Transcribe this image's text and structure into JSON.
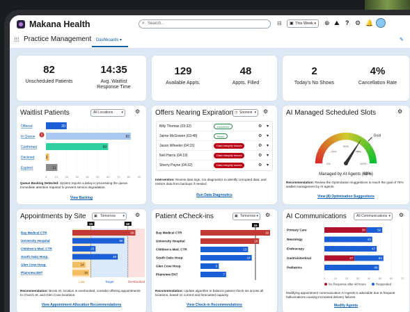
{
  "app": {
    "title": "Makana Health",
    "search_placeholder": "Search...",
    "nav_title": "Practice Management",
    "tab": "Dashboards",
    "period": "This Week"
  },
  "kpis": [
    {
      "value": "82",
      "label": "Unscheduled Patients"
    },
    {
      "value": "14:35",
      "label": "Avg. Waitlist Response Time"
    },
    {
      "value": "129",
      "label": "Available Appts."
    },
    {
      "value": "48",
      "label": "Appts. Filled"
    },
    {
      "value": "2",
      "label": "Today's No Shows"
    },
    {
      "value": "4%",
      "label": "Cancellation Rate"
    }
  ],
  "waitlist": {
    "title": "Waitlist Patients",
    "filter": "All Locations",
    "summary_bold": "Queue Backlog Detected:",
    "summary": "System reports a delay in processing the queue. Immediate attention required to prevent service degradation.",
    "link": "View Backlog",
    "badge": "!",
    "chart_data": {
      "type": "bar",
      "categories": [
        "Offered",
        "In Queue",
        "Confirmed",
        "Declined",
        "Expired"
      ],
      "values": [
        20,
        82,
        60,
        3,
        11
      ],
      "colors": [
        "#1b5fd6",
        "#a9c8f2",
        "#2fd0a0",
        "#f5bd62",
        "#8a8a8a"
      ],
      "xticks": [
        "0",
        "10",
        "20",
        "30",
        "40",
        "50",
        "60",
        "70",
        "80",
        "90"
      ],
      "xlim": [
        0,
        90
      ]
    }
  },
  "offers": {
    "title": "Offers Nearing Expiration",
    "filter": "Soonest",
    "rows": [
      {
        "name": "Billy Thomas (03:32)",
        "status": "Delivered",
        "kind": "ok"
      },
      {
        "name": "Jaime McGowen (03:48)",
        "status": "Read",
        "kind": "ok"
      },
      {
        "name": "Jason Wheeler (04:15)",
        "status": "Data Integrity Issues",
        "kind": "bad"
      },
      {
        "name": "Neil Harris (04:19)",
        "status": "Data Integrity Issues",
        "kind": "bad"
      },
      {
        "name": "Sherry Payne (04:32)",
        "status": "Data Integrity Issues",
        "kind": "bad"
      }
    ],
    "summary_bold": "Intervention:",
    "summary": "Review data logs, run diagnostics to identify corrupted data, and restore data from backups if needed.",
    "link": "Run Data Diagnostics"
  },
  "ai_slots": {
    "title": "AI Managed Scheduled Slots",
    "gauge_labels": [
      "0%",
      "25%",
      "50%",
      "75%",
      "100%"
    ],
    "goal_label": "Goal",
    "caption_pre": "Managed by AI Agents (",
    "caption_val": "68%",
    "caption_post": ")",
    "summary_bold": "Recommendation:",
    "summary": "Review the Optimization Suggestions to reach the goal of 75% waitlist management by AI agents.",
    "link": "View (8) Optimization Suggestions",
    "chart_data": {
      "type": "gauge",
      "value": 68,
      "goal": 75,
      "min": 0,
      "max": 100
    }
  },
  "appts_site": {
    "title": "Appointments by Site",
    "filter": "Tomorrow",
    "top_labels": [
      "20",
      "60"
    ],
    "legend": [
      "Low",
      "Target",
      "Overbooked"
    ],
    "summary_bold": "Recommendation:",
    "summary": "Brook St. location is overbooked, consider offering appointments to Church St. and Glen Cove locations.",
    "link": "View Appointment Allocation Recommendations",
    "chart_data": {
      "type": "bar",
      "categories": [
        "Bay Medical CTR",
        "University Hospital",
        "Children's Med. CTR",
        "South Oaks Hosp.",
        "Glen Cove Hosp.",
        "Plainview ENT"
      ],
      "values": [
        68,
        56,
        25,
        49,
        14,
        18
      ],
      "low_threshold": 20,
      "target_threshold": 60
    }
  },
  "echeckins": {
    "title": "Patient eCheck-ins",
    "filter": "Tomorrow",
    "top_label": "15",
    "summary_bold": "Recommendation:",
    "summary": "Update algorithm to balance patient check-ins across all locations, based on current and forecasted capacity.",
    "link": "View Check-in Recommendations",
    "chart_data": {
      "type": "bar",
      "categories": [
        "Bay Medical CTR",
        "University Hospital",
        "Children's Med. CTR",
        "South Oaks Hosp.",
        "Glen Cove Hosp.",
        "Plainview ENT"
      ],
      "values": [
        19,
        16,
        13,
        14,
        5,
        7
      ],
      "reference": 15,
      "xlim": [
        0,
        19
      ]
    }
  },
  "ai_comms": {
    "title": "AI Communications",
    "filter": "All Communications",
    "summary": "Modifying appointment communication AI Agents is advisable due to frequent hallucinations causing increased delivery failures.",
    "link": "Modify Agents",
    "chart_data": {
      "type": "bar",
      "categories": [
        "Primary Care",
        "Neurology",
        "Endoscopy",
        "Gastrointestinal",
        "Pediatrics"
      ],
      "series": [
        {
          "name": "No Response after 48 hours",
          "color": "#b0122d",
          "values": [
            38,
            null,
            null,
            27,
            null
          ]
        },
        {
          "name": "Responded",
          "color": "#1b5fd6",
          "values": [
            52,
            43,
            47,
            53,
            49
          ]
        }
      ],
      "xticks": [
        "0",
        "10",
        "20",
        "30",
        "40",
        "50",
        "60",
        "70"
      ],
      "xlim": [
        0,
        70
      ]
    }
  }
}
